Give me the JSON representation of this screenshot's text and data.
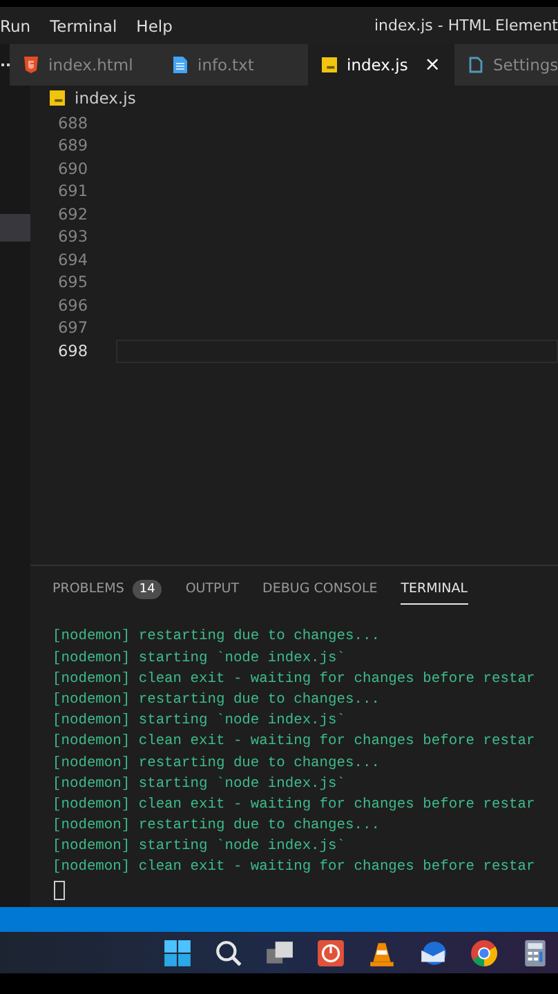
{
  "menu": [
    {
      "label": "Run"
    },
    {
      "label": "Terminal"
    },
    {
      "label": "Help"
    }
  ],
  "window": {
    "title": "index.js - HTML Element"
  },
  "tabs": [
    {
      "label": "index.html",
      "kind": "html",
      "selected": false
    },
    {
      "label": "info.txt",
      "kind": "txt",
      "selected": false
    },
    {
      "label": "index.js",
      "kind": "js",
      "selected": true,
      "close": "×"
    },
    {
      "label": "Settings",
      "kind": "settings",
      "selected": false
    }
  ],
  "breadcrumb": {
    "label": "index.js",
    "kind": "js"
  },
  "editor": {
    "lines": [
      {
        "number": "688",
        "current": false
      },
      {
        "number": "689",
        "current": false
      },
      {
        "number": "690",
        "current": false
      },
      {
        "number": "691",
        "current": false
      },
      {
        "number": "692",
        "current": false
      },
      {
        "number": "693",
        "current": false
      },
      {
        "number": "694",
        "current": false
      },
      {
        "number": "695",
        "current": false
      },
      {
        "number": "696",
        "current": false
      },
      {
        "number": "697",
        "current": false
      },
      {
        "number": "698",
        "current": true
      }
    ]
  },
  "panel": {
    "tabs": [
      {
        "label": "PROBLEMS",
        "badge": "14",
        "selected": false
      },
      {
        "label": "OUTPUT",
        "selected": false
      },
      {
        "label": "DEBUG CONSOLE",
        "selected": false
      },
      {
        "label": "TERMINAL",
        "selected": true
      }
    ],
    "terminal": [
      "[nodemon] restarting due to changes...",
      "[nodemon] starting `node index.js`",
      "[nodemon] clean exit - waiting for changes before restar",
      "[nodemon] restarting due to changes...",
      "[nodemon] starting `node index.js`",
      "[nodemon] clean exit - waiting for changes before restar",
      "[nodemon] restarting due to changes...",
      "[nodemon] starting `node index.js`",
      "[nodemon] clean exit - waiting for changes before restar",
      "[nodemon] restarting due to changes...",
      "[nodemon] starting `node index.js`",
      "[nodemon] clean exit - waiting for changes before restar"
    ]
  },
  "taskbar": [
    {
      "kind": "start"
    },
    {
      "kind": "search"
    },
    {
      "kind": "taskview"
    },
    {
      "kind": "power"
    },
    {
      "kind": "cone"
    },
    {
      "kind": "mail"
    },
    {
      "kind": "browser"
    },
    {
      "kind": "calculator"
    }
  ]
}
